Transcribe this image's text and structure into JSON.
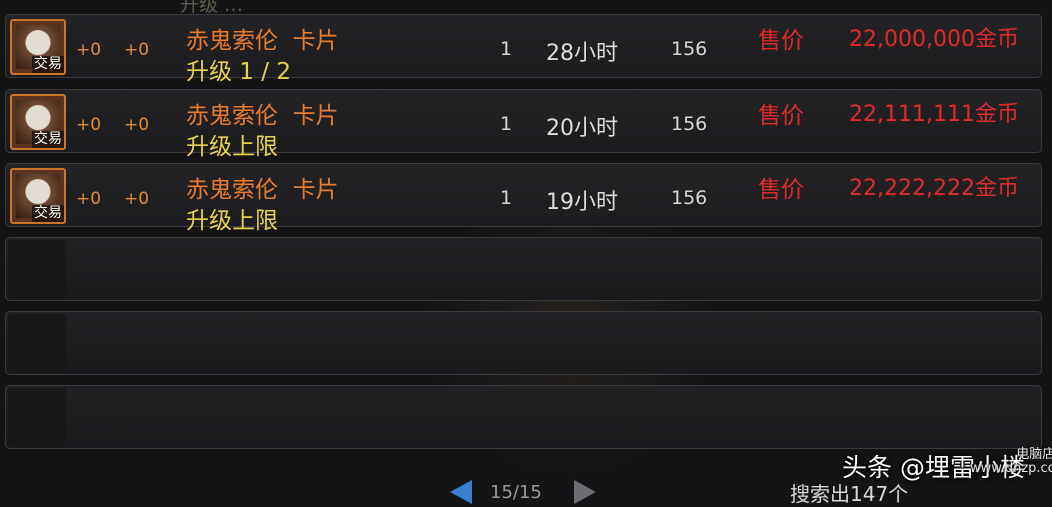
{
  "listings": [
    {
      "icon": "card-icon",
      "trade_tag": "交易",
      "plus1": "+0",
      "plus2": "+0",
      "name": "赤鬼索伦  卡片",
      "upgrade": "升级 1 / 2",
      "quantity": "1",
      "time": "28小时",
      "level": "156",
      "price_label": "售价",
      "price": "22,000,000金币"
    },
    {
      "icon": "card-icon",
      "trade_tag": "交易",
      "plus1": "+0",
      "plus2": "+0",
      "name": "赤鬼索伦  卡片",
      "upgrade": "升级上限",
      "quantity": "1",
      "time": "20小时",
      "level": "156",
      "price_label": "售价",
      "price": "22,111,111金币"
    },
    {
      "icon": "card-icon",
      "trade_tag": "交易",
      "plus1": "+0",
      "plus2": "+0",
      "name": "赤鬼索伦  卡片",
      "upgrade": "升级上限",
      "quantity": "1",
      "time": "19小时",
      "level": "156",
      "price_label": "售价",
      "price": "22,222,222金币"
    }
  ],
  "partial_top_text": "升级 …",
  "pager": {
    "page": "15/15",
    "prev_icon": "arrow-left-icon",
    "next_icon": "arrow-right-icon"
  },
  "search_count": "搜索出147个",
  "watermark": {
    "main": "头条 @埋雷小楼",
    "site_line1": "电脑店网",
    "site_line2": "www.dnzp.com"
  },
  "colors": {
    "name": "#e87c2c",
    "upgrade": "#e7d24f",
    "price": "#e02a2a",
    "plus": "#e08a3a",
    "icon_border": "#c8772a"
  }
}
